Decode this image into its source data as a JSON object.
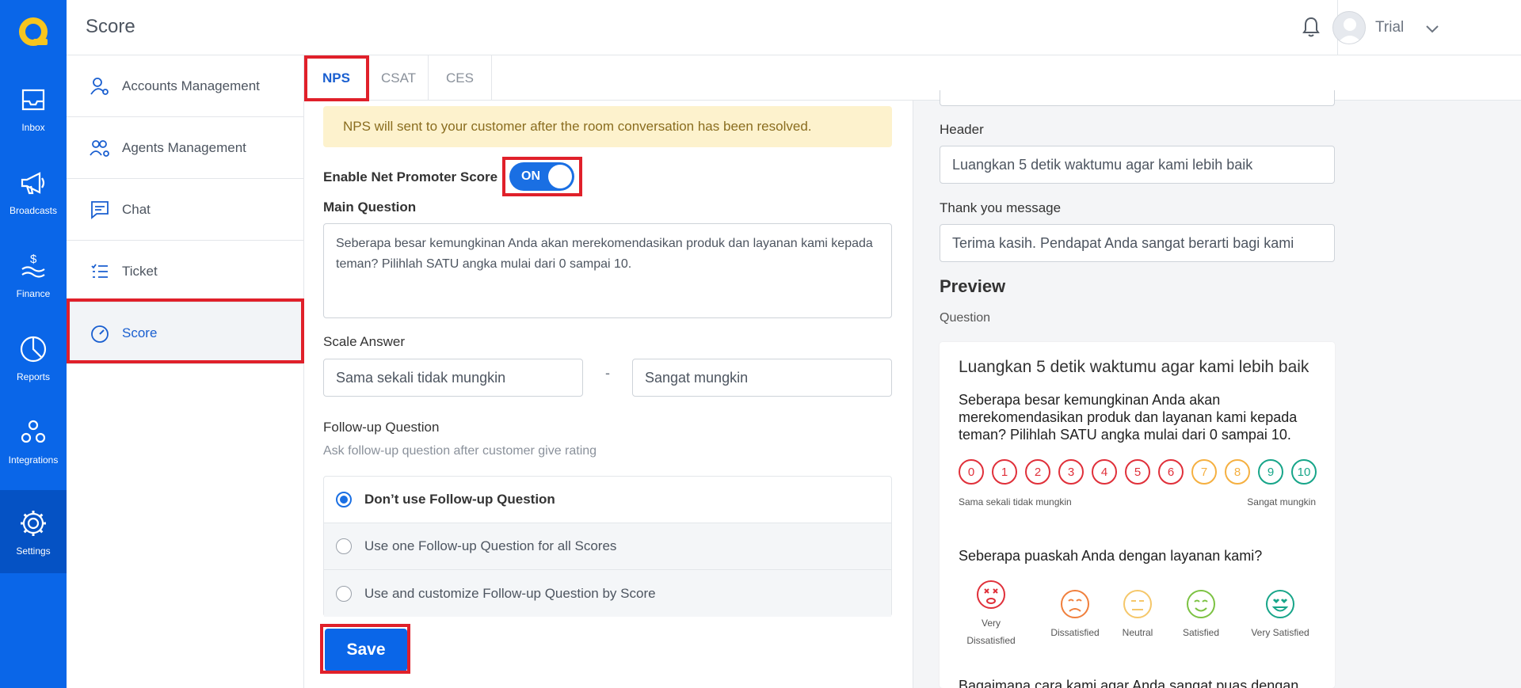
{
  "app": {
    "page_title": "Score"
  },
  "user": {
    "name": "Trial"
  },
  "rail": {
    "items": [
      {
        "label": "Inbox"
      },
      {
        "label": "Broadcasts"
      },
      {
        "label": "Finance"
      },
      {
        "label": "Reports"
      },
      {
        "label": "Integrations"
      },
      {
        "label": "Settings"
      }
    ]
  },
  "submenu": {
    "items": [
      {
        "label": "Accounts Management"
      },
      {
        "label": "Agents Management"
      },
      {
        "label": "Chat"
      },
      {
        "label": "Ticket"
      },
      {
        "label": "Score"
      }
    ],
    "active": "Score"
  },
  "tabs": [
    {
      "label": "NPS"
    },
    {
      "label": "CSAT"
    },
    {
      "label": "CES"
    }
  ],
  "form": {
    "info": "NPS will sent to your customer after the room conversation has been resolved.",
    "enable_label": "Enable Net Promoter Score",
    "toggle_label": "ON",
    "main_question_label": "Main Question",
    "main_question_value": "Seberapa besar kemungkinan Anda akan merekomendasikan produk dan layanan kami kepada teman? Pilihlah SATU angka mulai dari 0 sampai 10.",
    "scale_label": "Scale Answer",
    "scale_min": "Sama sekali tidak mungkin",
    "scale_sep": "-",
    "scale_max": "Sangat mungkin",
    "followup_label": "Follow-up Question",
    "followup_hint": "Ask follow-up question after customer give rating",
    "followup_options": [
      "Don’t use Follow-up Question",
      "Use one Follow-up Question for all Scores",
      "Use and customize Follow-up Question by Score"
    ],
    "save_label": "Save"
  },
  "settings": {
    "header_label": "Header",
    "header_value": "Luangkan 5 detik waktumu agar kami lebih baik",
    "thanks_label": "Thank you message",
    "thanks_value": "Terima kasih. Pendapat Anda sangat berarti bagi kami",
    "preview_title": "Preview",
    "preview_sub": "Question"
  },
  "preview": {
    "header": "Luangkan 5 detik waktumu agar kami lebih baik",
    "question": "Seberapa besar kemungkinan Anda akan merekomendasikan produk dan layanan kami kepada teman? Pilihlah SATU angka mulai dari 0 sampai 10.",
    "numbers": [
      "0",
      "1",
      "2",
      "3",
      "4",
      "5",
      "6",
      "7",
      "8",
      "9",
      "10"
    ],
    "scale_left": "Sama sekali tidak mungkin",
    "scale_right": "Sangat mungkin",
    "q2": "Seberapa puaskah Anda dengan layanan kami?",
    "faces": [
      "Very Dissatisfied",
      "Dissatisfied",
      "Neutral",
      "Satisfied",
      "Very Satisfied"
    ],
    "cut_text": "Bagaimana cara kami agar Anda sangat puas dengan produk"
  },
  "colors": {
    "brand": "#0a66e8",
    "highlight": "#e0202a",
    "detractor": "#e0303a",
    "passive": "#f5b041",
    "promoter": "#17a589"
  }
}
